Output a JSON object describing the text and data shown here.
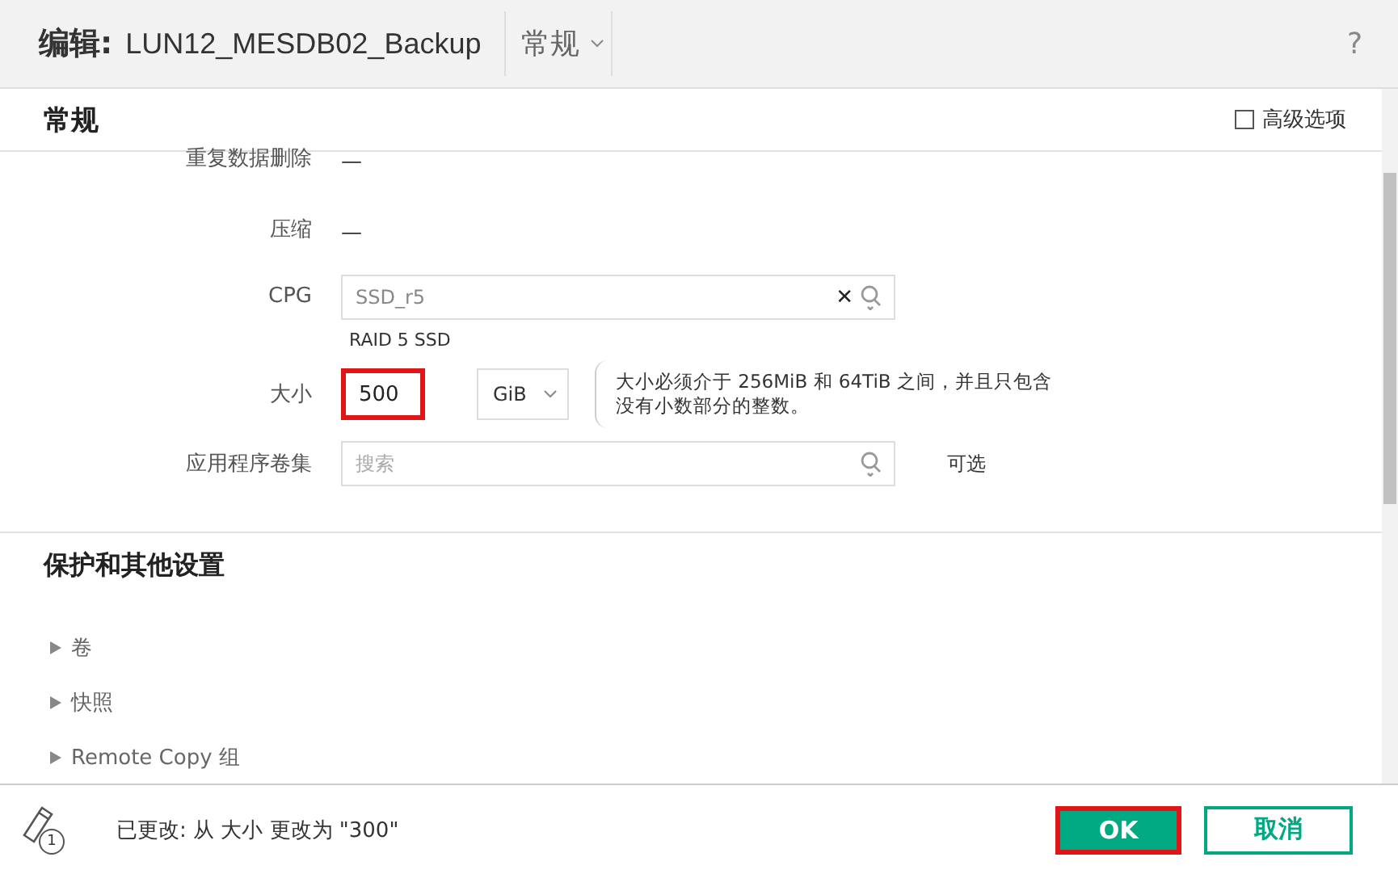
{
  "header": {
    "prefix": "编辑:",
    "title": "LUN12_MESDB02_Backup",
    "view": "常规",
    "help": "?"
  },
  "section": {
    "title": "常规",
    "advanced": {
      "label": "高级选项",
      "checked": false
    }
  },
  "fields": [
    {
      "kind": "text",
      "label": "重复数据删除",
      "value": "—"
    },
    {
      "kind": "text",
      "label": "压缩",
      "value": "—"
    },
    {
      "kind": "search",
      "label": "CPG",
      "value": "SSD_r5",
      "clear": "✕",
      "note": "RAID 5 SSD"
    },
    {
      "kind": "size",
      "label": "大小",
      "value": "500",
      "highlighted": true,
      "unit": "GiB",
      "tooltip": "大小必须介于 256MiB 和 64TiB 之间，并且只包含没有小数部分的整数。"
    },
    {
      "kind": "search",
      "label": "应用程序卷集",
      "placeholder": "搜索",
      "hint": "可选"
    }
  ],
  "protection": {
    "title": "保护和其他设置",
    "groups": [
      {
        "label": "卷",
        "expanded": false
      },
      {
        "label": "快照",
        "expanded": false
      },
      {
        "label": "Remote Copy 组",
        "expanded": false
      }
    ]
  },
  "footer": {
    "badge": "1",
    "message": "已更改: 从 大小 更改为 \"300\"",
    "buttons": [
      {
        "kind": "primary",
        "label": "OK",
        "highlighted": true
      },
      {
        "kind": "secondary",
        "label": "取消",
        "highlighted": false
      }
    ]
  }
}
